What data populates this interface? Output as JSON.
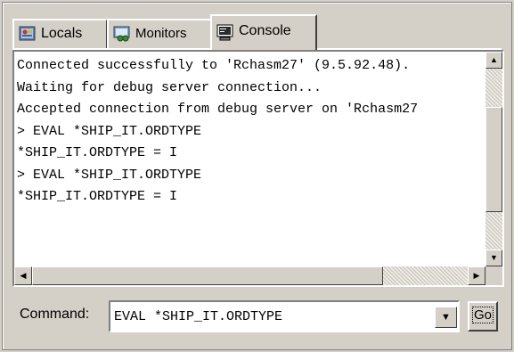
{
  "tabs": [
    {
      "label": "Locals",
      "icon": "locals-icon",
      "active": false
    },
    {
      "label": "Monitors",
      "icon": "monitors-icon",
      "active": false
    },
    {
      "label": "Console",
      "icon": "console-icon",
      "active": true
    }
  ],
  "console": {
    "lines": [
      "Connected successfully to 'Rchasm27' (9.5.92.48).",
      "Waiting for debug server connection...",
      "Accepted connection from debug server on 'Rchasm27",
      "> EVAL *SHIP_IT.ORDTYPE",
      "*SHIP_IT.ORDTYPE = I",
      "> EVAL *SHIP_IT.ORDTYPE",
      "*SHIP_IT.ORDTYPE = I"
    ]
  },
  "command": {
    "label": "Command:",
    "value": "EVAL *SHIP_IT.ORDTYPE",
    "go_label": "Go"
  },
  "scrollbar_icons": {
    "up": "arrow-up-icon",
    "down": "arrow-down-icon",
    "left": "arrow-left-icon",
    "right": "arrow-right-icon"
  }
}
